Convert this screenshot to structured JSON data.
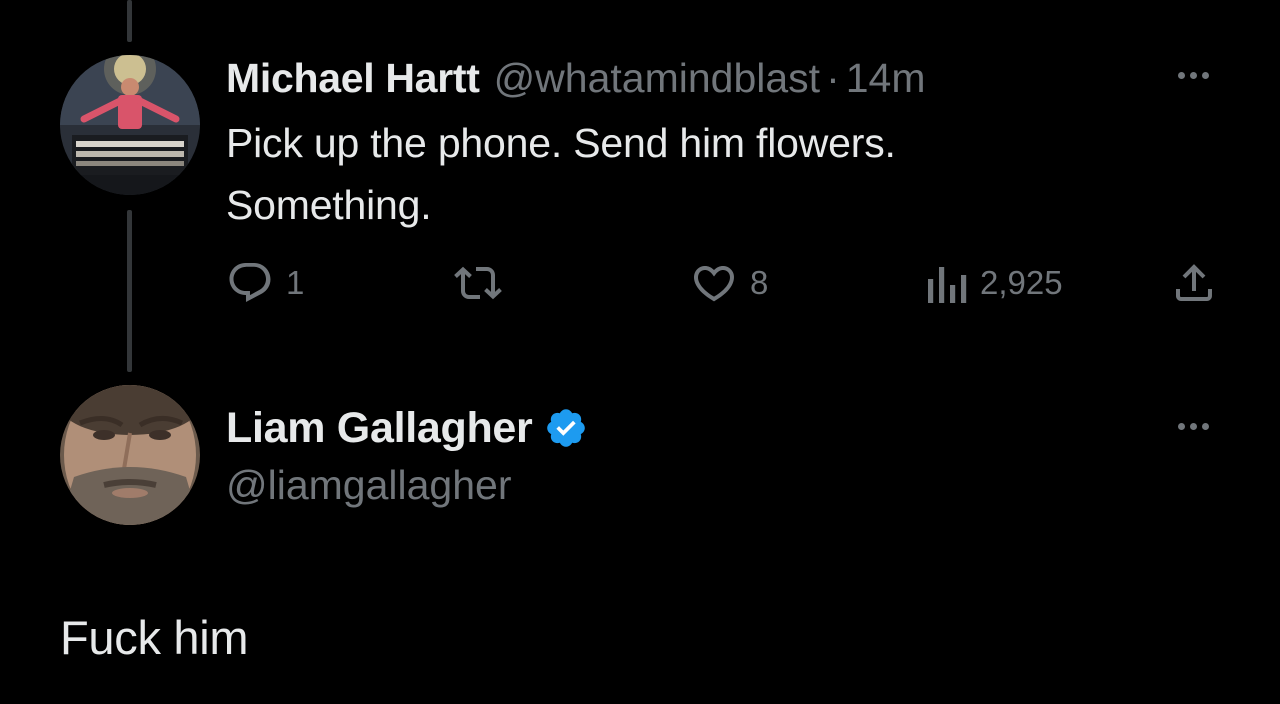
{
  "parent_tweet": {
    "display_name": "Michael Hartt",
    "handle": "@whatamindblast",
    "separator": "·",
    "time": "14m",
    "text_lines": [
      "Pick up the phone. Send him flowers.",
      "Something."
    ],
    "actions": {
      "reply_count": "1",
      "retweet_count": "",
      "like_count": "8",
      "view_count": "2,925"
    }
  },
  "reply_tweet": {
    "display_name": "Liam Gallagher",
    "verified": true,
    "handle": "@liamgallagher",
    "text": "Fuck him"
  },
  "icons": {
    "reply": "speech-bubble-icon",
    "retweet": "retweet-arrows-icon",
    "like": "heart-icon",
    "views": "bar-chart-icon",
    "share": "share-upload-icon",
    "more": "more-dots-icon",
    "verified": "verified-badge-icon"
  },
  "colors": {
    "background": "#000000",
    "primary_text": "#e7e9ea",
    "secondary_text": "#71767b",
    "thread_line": "#333639",
    "verified_blue": "#1d9bf0"
  }
}
